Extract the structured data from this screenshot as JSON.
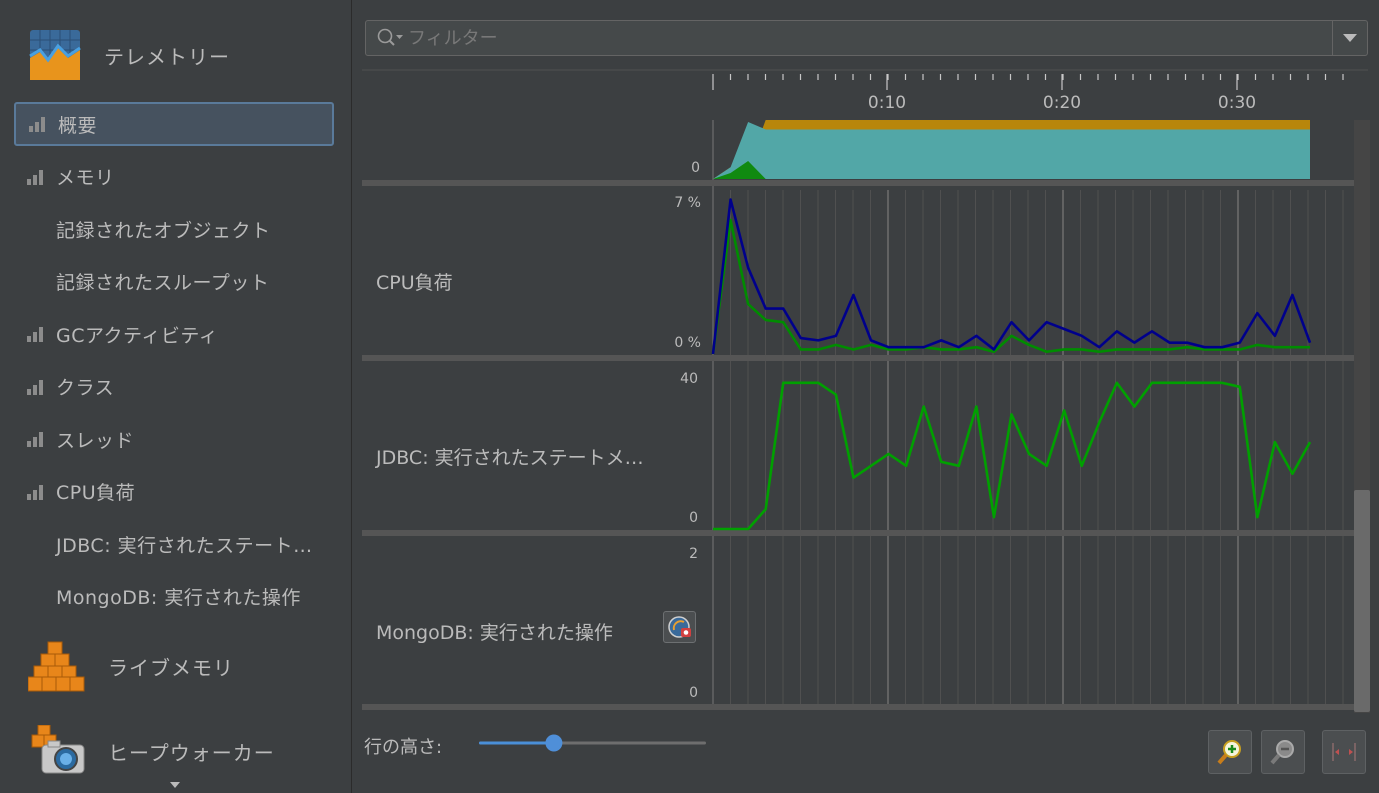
{
  "sidebar": {
    "telemetry_label": "テレメトリー",
    "items": [
      {
        "label": "概要",
        "bars": true,
        "active": true
      },
      {
        "label": "メモリ",
        "bars": true
      },
      {
        "label": "記録されたオブジェクト",
        "bars": false
      },
      {
        "label": "記録されたスループット",
        "bars": false
      },
      {
        "label": "GCアクティビティ",
        "bars": true
      },
      {
        "label": "クラス",
        "bars": true
      },
      {
        "label": "スレッド",
        "bars": true
      },
      {
        "label": "CPU負荷",
        "bars": true
      },
      {
        "label": "JDBC: 実行されたステート…",
        "bars": false
      },
      {
        "label": "MongoDB: 実行された操作",
        "bars": false
      }
    ],
    "live_memory_label": "ライブメモリ",
    "heap_walker_label": "ヒープウォーカー"
  },
  "filter": {
    "placeholder": "フィルター"
  },
  "timeline": {
    "ticks": [
      "0:10",
      "0:20",
      "0:30"
    ]
  },
  "rows": [
    {
      "label": "",
      "max": "",
      "min": "0"
    },
    {
      "label": "CPU負荷",
      "max": "7 %",
      "min": "0 %"
    },
    {
      "label": "JDBC: 実行されたステートメ…",
      "max": "40",
      "min": "0"
    },
    {
      "label": "MongoDB: 実行された操作",
      "max": "2",
      "min": "0"
    }
  ],
  "bottom": {
    "row_height_label": "行の高さ:",
    "row_height_value": 0.33
  },
  "colors": {
    "memory_used": "#52a7a7",
    "memory_free": "#b8860b",
    "cpu_line": "#00008b",
    "gc_line": "#008c00",
    "jdbc_line": "#00a000"
  },
  "chart_data": [
    {
      "type": "area",
      "series": [
        {
          "name": "",
          "values": [
            0,
            0.2,
            0.2,
            1,
            1,
            1,
            1,
            1,
            1,
            1,
            1,
            1,
            1,
            1,
            1,
            1,
            1,
            1,
            1,
            1,
            1,
            1,
            1,
            1,
            1,
            1,
            1,
            1,
            1,
            1,
            1,
            1,
            1,
            1,
            1,
            1
          ]
        }
      ]
    },
    {
      "type": "line",
      "ylim": [
        0,
        7
      ],
      "series": [
        {
          "name": "",
          "values": [
            0,
            6.8,
            3.8,
            2.0,
            2.0,
            0.7,
            0.6,
            0.8,
            2.6,
            0.6,
            0.3,
            0.3,
            0.3,
            0.6,
            0.3,
            0.8,
            0.2,
            1.4,
            0.6,
            1.4,
            1.1,
            0.8,
            0.3,
            1.0,
            0.5,
            1.0,
            0.5,
            0.5,
            0.3,
            0.3,
            0.5,
            1.8,
            0.8,
            2.6,
            0.5
          ]
        },
        {
          "name": "",
          "values": [
            0,
            5.9,
            2.2,
            1.5,
            1.4,
            0.2,
            0.2,
            0.4,
            0.2,
            0.4,
            0.2,
            0.2,
            0.3,
            0.2,
            0.2,
            0.3,
            0.1,
            0.8,
            0.4,
            0.1,
            0.2,
            0.2,
            0.1,
            0.2,
            0.2,
            0.2,
            0.2,
            0.3,
            0.2,
            0.2,
            0.2,
            0.4,
            0.3,
            0.3,
            0.3
          ]
        }
      ]
    },
    {
      "type": "line",
      "ylim": [
        0,
        40
      ],
      "series": [
        {
          "name": "",
          "values": [
            0,
            0,
            0,
            5,
            37,
            37,
            37,
            34,
            13,
            16,
            19,
            16,
            31,
            17,
            16,
            31,
            3,
            29,
            19,
            16,
            30,
            16,
            27,
            37,
            31,
            37,
            37,
            37,
            37,
            37,
            36,
            3,
            22,
            14,
            22
          ]
        }
      ]
    },
    {
      "type": "line",
      "ylim": [
        0,
        2
      ],
      "series": []
    }
  ]
}
